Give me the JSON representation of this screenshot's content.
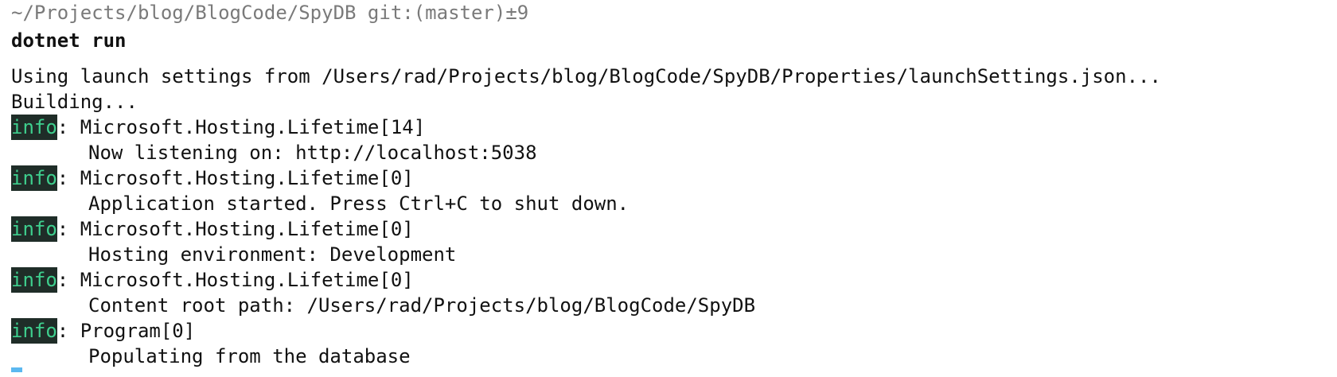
{
  "terminal": {
    "prompt": "~/Projects/blog/BlogCode/SpyDB git:(master)±9",
    "command": "dotnet run",
    "output_lines": [
      "Using launch settings from /Users/rad/Projects/blog/BlogCode/SpyDB/Properties/launchSettings.json...",
      "Building..."
    ],
    "log_entries": [
      {
        "level": "info",
        "category": ": Microsoft.Hosting.Lifetime[14]",
        "message": "Now listening on: http://localhost:5038"
      },
      {
        "level": "info",
        "category": ": Microsoft.Hosting.Lifetime[0]",
        "message": "Application started. Press Ctrl+C to shut down."
      },
      {
        "level": "info",
        "category": ": Microsoft.Hosting.Lifetime[0]",
        "message": "Hosting environment: Development"
      },
      {
        "level": "info",
        "category": ": Microsoft.Hosting.Lifetime[0]",
        "message": "Content root path: /Users/rad/Projects/blog/BlogCode/SpyDB"
      },
      {
        "level": "info",
        "category": ": Program[0]",
        "message": "Populating from the database"
      }
    ]
  },
  "colors": {
    "prompt_text": "#7a7a7a",
    "info_badge_bg": "#1f2d28",
    "info_badge_text": "#3ecf8e",
    "cursor": "#5bb8f0"
  }
}
